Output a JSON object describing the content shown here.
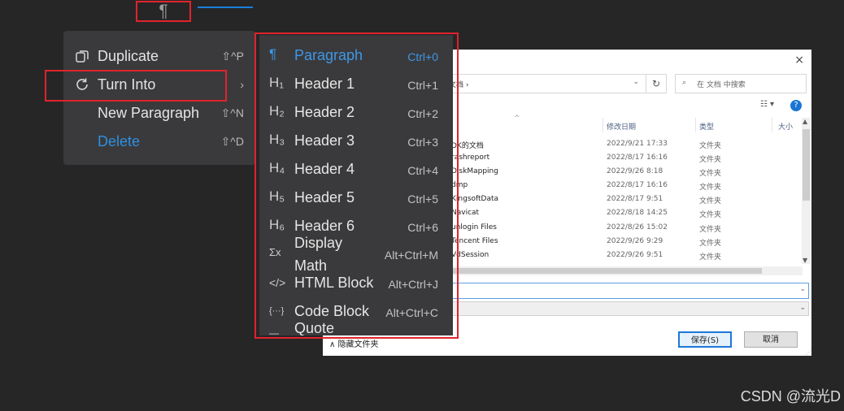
{
  "toolbar": {
    "paragraph_icon": "¶"
  },
  "context_menu": {
    "items": [
      {
        "label": "Duplicate",
        "shortcut": "⇧^P",
        "icon": "duplicate-icon"
      },
      {
        "label": "Turn Into",
        "shortcut": "›",
        "icon": "refresh-icon"
      },
      {
        "label": "New Paragraph",
        "shortcut": "⇧^N",
        "icon": ""
      },
      {
        "label": "Delete",
        "shortcut": "⇧^D",
        "icon": "",
        "color": "#2f8fe0"
      }
    ]
  },
  "turn_into_menu": {
    "items": [
      {
        "glyph": "¶",
        "label": "Paragraph",
        "shortcut": "Ctrl+0"
      },
      {
        "glyph": "H₁",
        "label": "Header 1",
        "shortcut": "Ctrl+1"
      },
      {
        "glyph": "H₂",
        "label": "Header 2",
        "shortcut": "Ctrl+2"
      },
      {
        "glyph": "H₃",
        "label": "Header 3",
        "shortcut": "Ctrl+3"
      },
      {
        "glyph": "H₄",
        "label": "Header 4",
        "shortcut": "Ctrl+4"
      },
      {
        "glyph": "H₅",
        "label": "Header 5",
        "shortcut": "Ctrl+5"
      },
      {
        "glyph": "H₆",
        "label": "Header 6",
        "shortcut": "Ctrl+6"
      },
      {
        "glyph": "Σx",
        "label_line1": "Display",
        "label_line2": "Math",
        "shortcut": "Alt+Ctrl+M"
      },
      {
        "glyph": "</>",
        "label": "HTML Block",
        "shortcut": "Alt+Ctrl+J"
      },
      {
        "glyph": "{···}",
        "label": "Code Block",
        "shortcut": "Alt+Ctrl+C"
      },
      {
        "glyph": "—",
        "label": "Quote",
        "shortcut": ""
      }
    ],
    "active_color": "#3d97e6"
  },
  "file_dialog": {
    "close": "×",
    "path_tail": "文档 ›",
    "search_placeholder": "在 文档 中搜索",
    "columns": {
      "date": "修改日期",
      "type": "类型",
      "size": "大小"
    },
    "rows": [
      {
        "name": "DK的文档",
        "date": "2022/9/21 17:33",
        "type": "文件夹"
      },
      {
        "name": "rashreport",
        "date": "2022/8/17 16:16",
        "type": "文件夹"
      },
      {
        "name": "DiskMapping",
        "date": "2022/9/26 8:18",
        "type": "文件夹"
      },
      {
        "name": "dmp",
        "date": "2022/8/17 16:16",
        "type": "文件夹"
      },
      {
        "name": "KingsoftData",
        "date": "2022/8/17 9:51",
        "type": "文件夹"
      },
      {
        "name": "Navicat",
        "date": "2022/8/18 14:25",
        "type": "文件夹"
      },
      {
        "name": "unlogin Files",
        "date": "2022/8/26 15:02",
        "type": "文件夹"
      },
      {
        "name": "Tencent Files",
        "date": "2022/9/26 9:29",
        "type": "文件夹"
      },
      {
        "name": "VdSession",
        "date": "2022/9/26 9:51",
        "type": "文件夹"
      }
    ],
    "hide_folders": "隐藏文件夹",
    "save_button": "保存(S)",
    "cancel_button": "取消"
  },
  "watermark": "CSDN @流光D",
  "colors": {
    "highlight_red": "#e0232b",
    "menu_bg": "#3a3a3c",
    "accent_blue": "#2f8fe0"
  }
}
